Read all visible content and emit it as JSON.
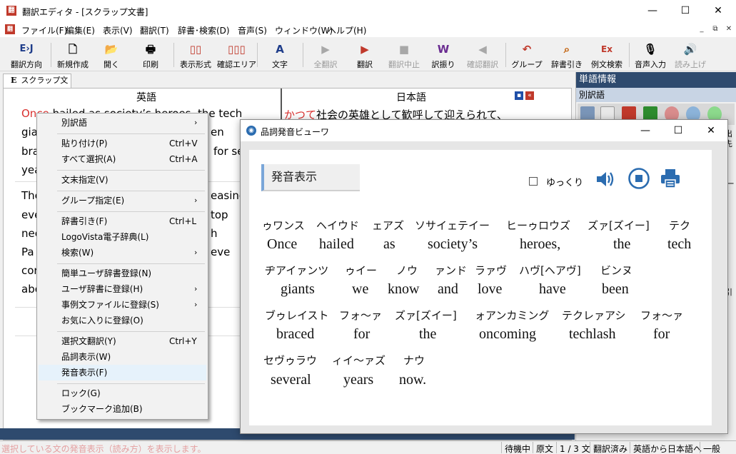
{
  "window": {
    "app_icon": "翻",
    "title": "翻訳エディタ - [スクラップ文書]",
    "buttons": {
      "minimize": "—",
      "maximize": "☐",
      "close": "✕"
    }
  },
  "menubar": {
    "items": [
      "ファイル(F)",
      "編集(E)",
      "表示(V)",
      "翻訳(T)",
      "辞書･検索(D)",
      "音声(S)",
      "ウィンドウ(W)",
      "ヘルプ(H)"
    ],
    "mdi_buttons": [
      "_",
      "⧉",
      "✕"
    ]
  },
  "toolbar": [
    {
      "label": "翻訳方向",
      "icon": "E›J",
      "disabled": false
    },
    {
      "label": "新規作成",
      "icon": "🗋",
      "disabled": false
    },
    {
      "label": "開く",
      "icon": "📂",
      "disabled": false
    },
    {
      "label": "印刷",
      "icon": "🖶",
      "disabled": false
    },
    {
      "label": "表示形式",
      "icon": "▯▯",
      "disabled": false
    },
    {
      "label": "確認エリア",
      "icon": "▯▯▯",
      "disabled": false
    },
    {
      "label": "文字",
      "icon": "A",
      "disabled": false
    },
    {
      "label": "全翻訳",
      "icon": "▶",
      "disabled": true
    },
    {
      "label": "翻訳",
      "icon": "▶",
      "disabled": false
    },
    {
      "label": "翻訳中止",
      "icon": "■",
      "disabled": true
    },
    {
      "label": "訳振り",
      "icon": "W",
      "disabled": false
    },
    {
      "label": "確認翻訳",
      "icon": "◀",
      "disabled": true
    },
    {
      "label": "グループ",
      "icon": "↶",
      "disabled": false
    },
    {
      "label": "辞書引き",
      "icon": "⌕",
      "disabled": false
    },
    {
      "label": "例文検索",
      "icon": "Ex",
      "disabled": false
    },
    {
      "label": "音声入力",
      "icon": "🎙",
      "disabled": false
    },
    {
      "label": "読み上げ",
      "icon": "🔊",
      "disabled": true
    }
  ],
  "document": {
    "tab_letter": "E",
    "tab_label": "スクラップ文書",
    "col_source": "英語",
    "col_target": "日本語",
    "source_lines": [
      {
        "red": "Once",
        "text": " hailed as society’s heroes, the tech"
      },
      {
        "red": "",
        "text": "gia"
      },
      {
        "red": "",
        "text": "bra"
      },
      {
        "red": "",
        "text": "yea"
      },
      {
        "red": "",
        "text": "The"
      },
      {
        "red": "",
        "text": "eve"
      },
      {
        "red": "",
        "text": "nee"
      },
      {
        "red": "",
        "text": "Pa"
      },
      {
        "red": "",
        "text": "cor"
      },
      {
        "red": "",
        "text": "abo"
      }
    ],
    "source_right_fragments": [
      "en",
      "for se",
      "easing",
      "top",
      "h",
      "eve"
    ],
    "target_red": "かつて",
    "target_text": "社会の英雄として歓呼して迎えられて、"
  },
  "right_panel": {
    "title": "単語情報",
    "subtitle": "別訳語",
    "edge_labels": [
      "出",
      "先",
      "一",
      "引"
    ]
  },
  "context_menu": {
    "items": [
      {
        "label": "別訳語",
        "shortcut": "",
        "arrow": "›",
        "highlight": false
      },
      {
        "label": "貼り付け(P)",
        "shortcut": "Ctrl+V",
        "arrow": "",
        "highlight": false
      },
      {
        "label": "すべて選択(A)",
        "shortcut": "Ctrl+A",
        "arrow": "",
        "highlight": false
      },
      {
        "label": "文末指定(V)",
        "shortcut": "",
        "arrow": "",
        "highlight": false
      },
      {
        "label": "グループ指定(E)",
        "shortcut": "",
        "arrow": "›",
        "highlight": false
      },
      {
        "label": "辞書引き(F)",
        "shortcut": "Ctrl+L",
        "arrow": "",
        "highlight": false
      },
      {
        "label": "LogoVista電子辞典(L)",
        "shortcut": "",
        "arrow": "",
        "highlight": false
      },
      {
        "label": "検索(W)",
        "shortcut": "",
        "arrow": "›",
        "highlight": false
      },
      {
        "label": "簡単ユーザ辞書登録(N)",
        "shortcut": "",
        "arrow": "",
        "highlight": false
      },
      {
        "label": "ユーザ辞書に登録(H)",
        "shortcut": "",
        "arrow": "›",
        "highlight": false
      },
      {
        "label": "事例文ファイルに登録(S)",
        "shortcut": "",
        "arrow": "›",
        "highlight": false
      },
      {
        "label": "お気に入りに登録(O)",
        "shortcut": "",
        "arrow": "",
        "highlight": false
      },
      {
        "label": "選択文翻訳(Y)",
        "shortcut": "Ctrl+Y",
        "arrow": "",
        "highlight": false
      },
      {
        "label": "品詞表示(W)",
        "shortcut": "",
        "arrow": "",
        "highlight": false
      },
      {
        "label": "発音表示(F)",
        "shortcut": "",
        "arrow": "",
        "highlight": true
      },
      {
        "label": "ロック(G)",
        "shortcut": "",
        "arrow": "",
        "highlight": false
      },
      {
        "label": "ブックマーク追加(B)",
        "shortcut": "",
        "arrow": "",
        "highlight": false
      }
    ]
  },
  "viewer": {
    "title": "品詞発音ビューワ",
    "section_label": "発音表示",
    "slow_checkbox_label": "ゆっくり",
    "slow_checked": false,
    "icons": [
      "speaker-icon",
      "stop-icon",
      "printer-icon"
    ],
    "accent_color": "#2b6cb0",
    "rows": [
      {
        "kana": [
          "ゥワンス",
          "ヘイウド",
          "ェアズ",
          "ソサイェテイー",
          "ヒーゥロウズ",
          "ズァ[ズイー]",
          "テク"
        ],
        "words": [
          "Once",
          "hailed",
          "as",
          "society’s",
          "heroes,",
          "the",
          "tech"
        ]
      },
      {
        "kana": [
          "ヂアイァンツ",
          "ゥイー",
          "ノウ",
          "ァンド",
          "ラァヴ",
          "ハヴ[ヘアヴ]",
          "ビンヌ"
        ],
        "words": [
          "giants",
          "we",
          "know",
          "and",
          "love",
          "have",
          "been"
        ]
      },
      {
        "kana": [
          "ブゥレイスト",
          "フォ～ァ",
          "ズァ[ズイー]",
          "ォアンカミング",
          "テクレァアシ",
          "フォ～ァ"
        ],
        "words": [
          "braced",
          "for",
          "the",
          "oncoming",
          "techlash",
          "for"
        ]
      },
      {
        "kana": [
          "セヴゥラウ",
          "ィイ～ァズ",
          "ナウ"
        ],
        "words": [
          "several",
          "years",
          "now."
        ]
      }
    ]
  },
  "statusbar": {
    "hint": "選択している文の発音表示（読み方）を表示します。",
    "segments": [
      "待機中",
      "原文",
      "1 / 3 文",
      "翻訳済み",
      "英語から日本語へ",
      "一般"
    ]
  }
}
